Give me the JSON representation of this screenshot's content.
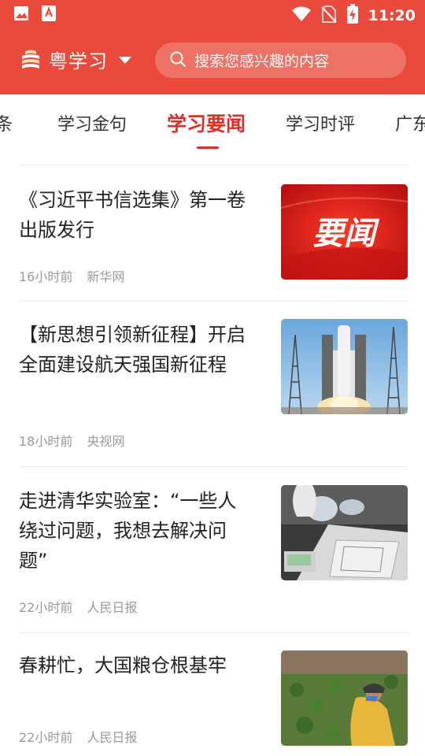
{
  "status_bar": {
    "time": "11:20",
    "left_icons": [
      "image-icon",
      "app-notification-icon"
    ],
    "right_icons": [
      "wifi-icon",
      "no-sim-icon",
      "battery-charging-icon"
    ]
  },
  "header": {
    "app_name": "粤学习",
    "search_placeholder": "搜索您感兴趣的内容",
    "accent_color": "#e94a3c"
  },
  "tabs": {
    "items": [
      "头条",
      "学习金句",
      "学习要闻",
      "学习时评",
      "广东"
    ],
    "visible_text": [
      "条",
      "学习金句",
      "学习要闻",
      "学习时评",
      "广东"
    ],
    "active": "学习要闻",
    "active_color": "#d9302a"
  },
  "news": [
    {
      "title": "《习近平书信选集》第一卷出版发行",
      "time": "16小时前",
      "source": "新华网",
      "thumb_text": "要闻",
      "thumb": "red-banner-yaowen"
    },
    {
      "title": "【新思想引领新征程】开启全面建设航天强国新征程",
      "time": "18小时前",
      "source": "央视网",
      "thumb": "rocket-launch-photo"
    },
    {
      "title": "走进清华实验室：“一些人绕过问题，我想去解决问题”",
      "time": "22小时前",
      "source": "人民日报",
      "thumb": "laboratory-photo"
    },
    {
      "title": "春耕忙，大国粮仓根基牢",
      "time": "22小时前",
      "source": "人民日报",
      "thumb": "farm-worker-photo"
    }
  ]
}
